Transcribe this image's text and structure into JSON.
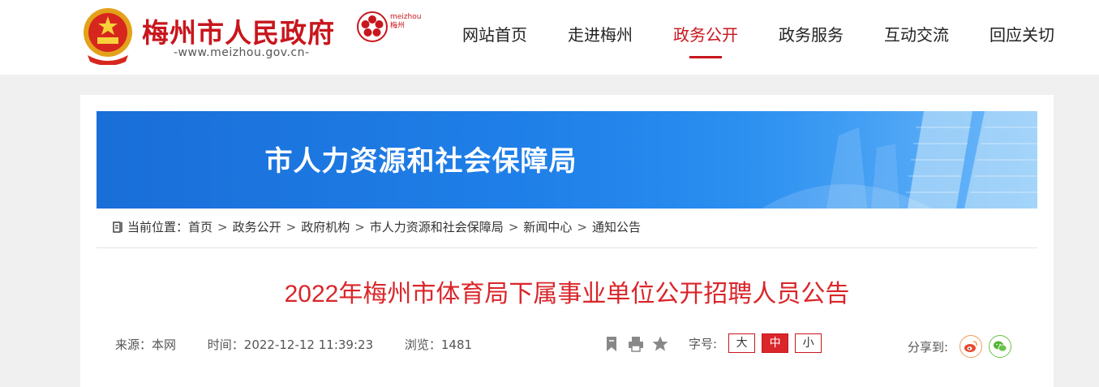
{
  "header": {
    "site_name": "梅州市人民政府",
    "site_url": "-www.meizhou.gov.cn-",
    "logo_text_line1": "meizhou",
    "logo_text_line2": "梅州",
    "nav": [
      {
        "label": "网站首页",
        "active": false
      },
      {
        "label": "走进梅州",
        "active": false
      },
      {
        "label": "政务公开",
        "active": true
      },
      {
        "label": "政务服务",
        "active": false
      },
      {
        "label": "互动交流",
        "active": false
      },
      {
        "label": "回应关切",
        "active": false
      }
    ]
  },
  "banner": {
    "title": "市人力资源和社会保障局"
  },
  "breadcrumb": {
    "prefix": "当前位置：",
    "items": [
      "首页",
      "政务公开",
      "政府机构",
      "市人力资源和社会保障局",
      "新闻中心",
      "通知公告"
    ],
    "separator": ">"
  },
  "article": {
    "title": "2022年梅州市体育局下属事业单位公开招聘人员公告",
    "source": "来源：本网",
    "time": "时间：2022-12-12 11:39:23",
    "views": "浏览：1481"
  },
  "toolbar": {
    "icons": [
      "bookmark-icon",
      "print-icon",
      "star-icon"
    ],
    "font_label": "字号:",
    "font_sizes": [
      "大",
      "中",
      "小"
    ],
    "active_font_size": "中",
    "share_label": "分享到:",
    "share_icons": [
      "weibo-icon",
      "wechat-icon"
    ]
  },
  "colors": {
    "brand": "#c8161d",
    "title_red": "#d9262b",
    "banner_blue": "#1f7fe8"
  }
}
